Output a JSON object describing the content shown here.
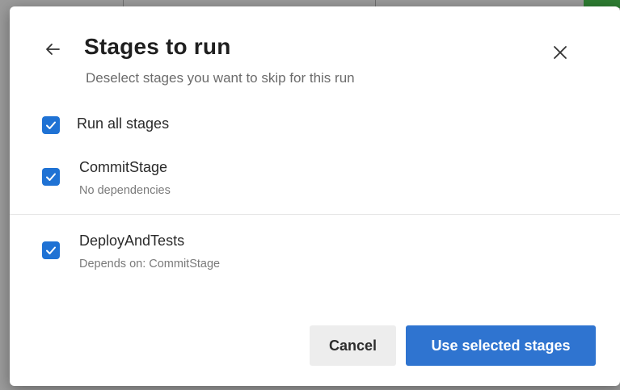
{
  "dialog": {
    "title": "Stages to run",
    "subtitle": "Deselect stages you want to skip for this run",
    "back_icon": "arrow-left-icon",
    "close_icon": "close-icon"
  },
  "run_all": {
    "label": "Run all stages",
    "checked": true
  },
  "stages": [
    {
      "name": "CommitStage",
      "detail": "No dependencies",
      "checked": true
    },
    {
      "name": "DeployAndTests",
      "detail": "Depends on: CommitStage",
      "checked": true
    }
  ],
  "buttons": {
    "cancel_label": "Cancel",
    "confirm_label": "Use selected stages"
  },
  "colors": {
    "accent": "#2f74d0",
    "checkbox": "#1f72d4",
    "cancel_bg": "#ededed"
  }
}
